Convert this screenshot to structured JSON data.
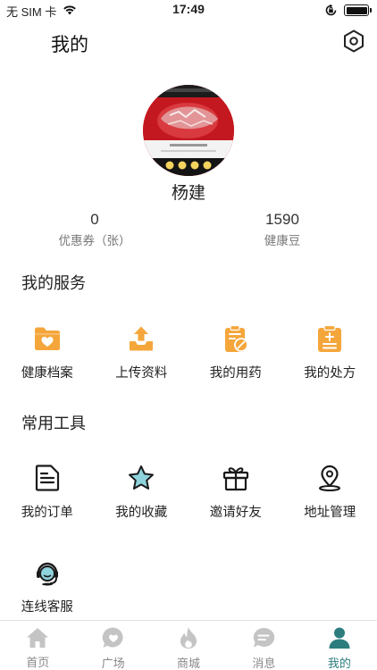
{
  "status_bar": {
    "carrier": "无 SIM 卡",
    "time": "17:49"
  },
  "header": {
    "title": "我的",
    "settings_icon": "gear-hexagon-icon"
  },
  "profile": {
    "name": "杨建"
  },
  "stats": {
    "coupon": {
      "value": "0",
      "label": "优惠券（张）"
    },
    "beans": {
      "value": "1590",
      "label": "健康豆"
    }
  },
  "services": {
    "title": "我的服务",
    "items": [
      {
        "label": "健康档案",
        "icon": "health-folder-icon"
      },
      {
        "label": "上传资料",
        "icon": "upload-tray-icon"
      },
      {
        "label": "我的用药",
        "icon": "medication-clipboard-icon"
      },
      {
        "label": "我的处方",
        "icon": "prescription-clipboard-icon"
      }
    ]
  },
  "tools": {
    "title": "常用工具",
    "items": [
      {
        "label": "我的订单",
        "icon": "order-document-icon"
      },
      {
        "label": "我的收藏",
        "icon": "star-icon"
      },
      {
        "label": "邀请好友",
        "icon": "gift-icon"
      },
      {
        "label": "地址管理",
        "icon": "location-pin-icon"
      },
      {
        "label": "连线客服",
        "icon": "customer-service-headset-icon"
      }
    ]
  },
  "tabbar": {
    "items": [
      {
        "label": "首页",
        "icon": "home-icon"
      },
      {
        "label": "广场",
        "icon": "heart-bubble-icon"
      },
      {
        "label": "商城",
        "icon": "flame-icon"
      },
      {
        "label": "消息",
        "icon": "chat-bubble-icon"
      },
      {
        "label": "我的",
        "icon": "user-icon"
      }
    ],
    "active": "我的"
  },
  "colors": {
    "accent": "#2d7d7e",
    "service_orange": "#f5a63b",
    "tab_inactive": "#c4c4c4",
    "star_fill": "#8fd3dc"
  }
}
